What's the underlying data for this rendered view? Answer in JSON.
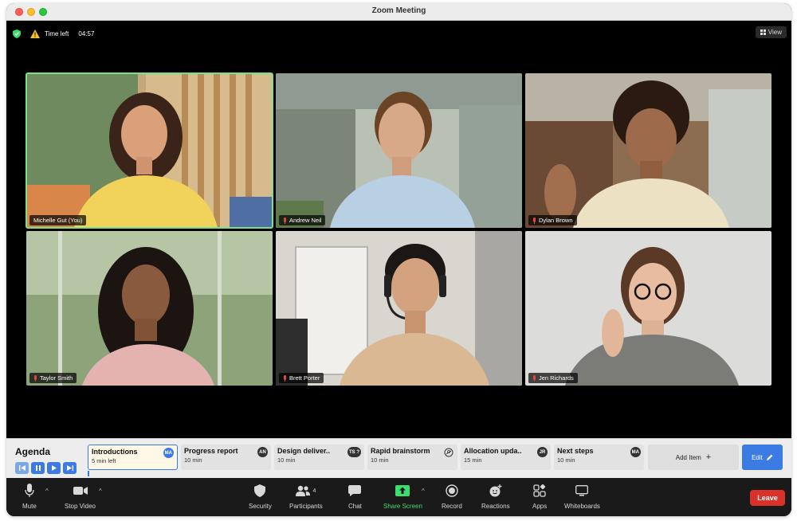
{
  "window": {
    "title": "Zoom Meeting"
  },
  "status": {
    "time_left_label": "Time left",
    "time_left_value": "04:57",
    "view_label": "View"
  },
  "participants": [
    {
      "name": "Michelle Gut (You)",
      "muted": false,
      "active": true
    },
    {
      "name": "Andrew Neil",
      "muted": true,
      "active": false
    },
    {
      "name": "Dylan Brown",
      "muted": true,
      "active": false
    },
    {
      "name": "Taylor Smith",
      "muted": true,
      "active": false
    },
    {
      "name": "Brett Porter",
      "muted": true,
      "active": false
    },
    {
      "name": "Jen Richards",
      "muted": true,
      "active": false
    }
  ],
  "agenda": {
    "title": "Agenda",
    "items": [
      {
        "title": "Introductions",
        "duration": "5 min left",
        "badge": "MA",
        "current": true
      },
      {
        "title": "Progress report",
        "duration": "10 min",
        "badge": "AN",
        "current": false
      },
      {
        "title": "Design deliver..",
        "duration": "10 min",
        "badge": "TS ?",
        "current": false
      },
      {
        "title": "Rapid brainstorm",
        "duration": "10 min",
        "badge": "",
        "current": false
      },
      {
        "title": "Allocation upda..",
        "duration": "15 min",
        "badge": "JR",
        "current": false
      },
      {
        "title": "Next steps",
        "duration": "10 min",
        "badge": "MA",
        "current": false
      }
    ],
    "add_item_label": "Add Item",
    "edit_label": "Edit"
  },
  "toolbar": {
    "mute": "Mute",
    "stop_video": "Stop Video",
    "security": "Security",
    "participants": "Participants",
    "participants_count": "4",
    "chat": "Chat",
    "share_screen": "Share Screen",
    "record": "Record",
    "reactions": "Reactions",
    "apps": "Apps",
    "whiteboards": "Whiteboards",
    "leave": "Leave"
  },
  "colors": {
    "accent": "#3c7be4",
    "leave": "#d9322b",
    "share": "#3ddc6d",
    "active_speaker": "#7be08a"
  }
}
